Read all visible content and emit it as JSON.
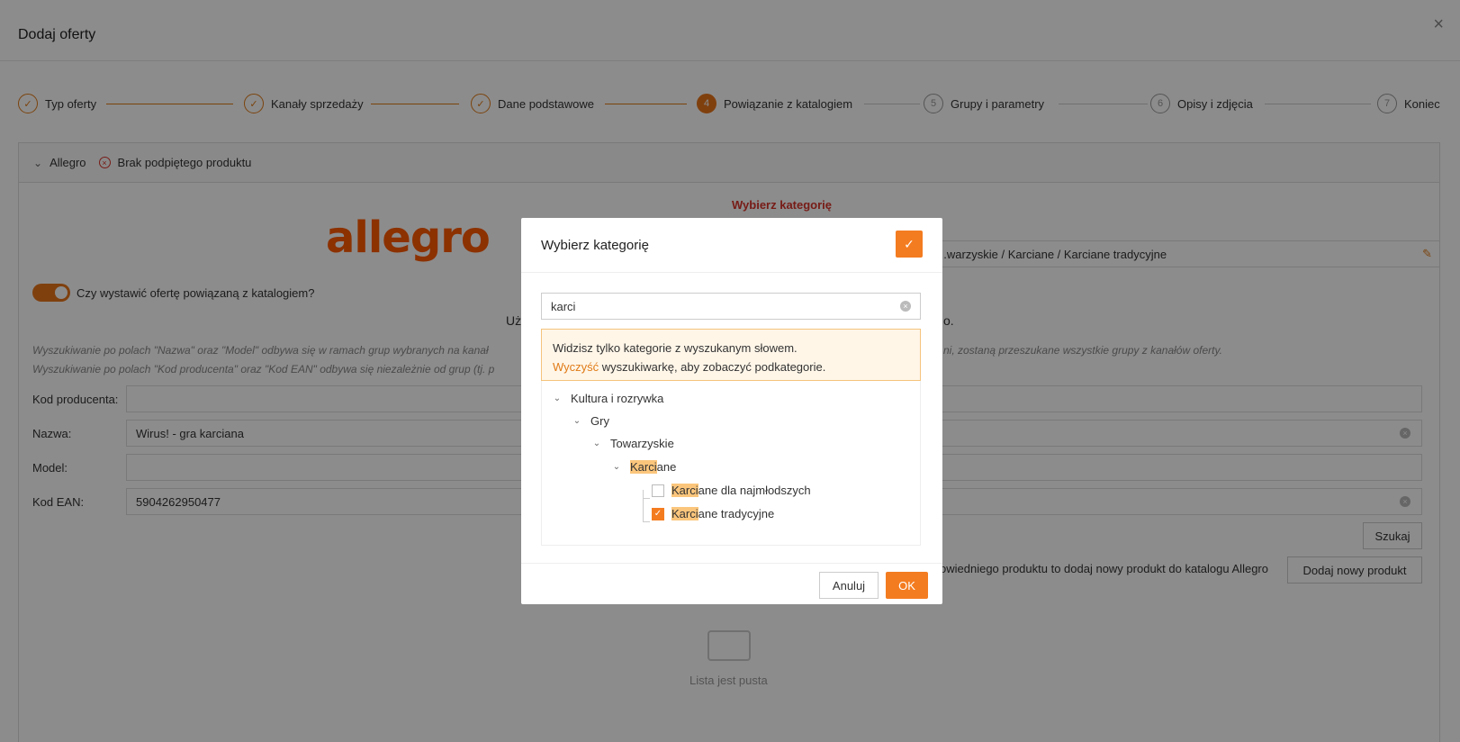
{
  "header": {
    "title": "Dodaj oferty",
    "close_icon": "×"
  },
  "steps": [
    {
      "label": "Typ oferty",
      "marker": "✓"
    },
    {
      "label": "Kanały sprzedaży",
      "marker": "✓"
    },
    {
      "label": "Dane podstawowe",
      "marker": "✓"
    },
    {
      "label": "Powiązanie z katalogiem",
      "marker": "4"
    },
    {
      "label": "Grupy i parametry",
      "marker": "5"
    },
    {
      "label": "Opisy i zdjęcia",
      "marker": "6"
    },
    {
      "label": "Koniec",
      "marker": "7"
    }
  ],
  "panel": {
    "chevron": "⌄",
    "channel": "Allegro",
    "error_icon": "×",
    "status": "Brak podpiętego produktu",
    "logo_text": "allegro",
    "category_title": "Wybierz kategorię",
    "category_path": "...warzyskie / Karciane / Karciane tradycyjne",
    "edit_icon": "✎",
    "toggle_label": "Czy wystawić ofertę powiązaną z katalogiem?",
    "center_note_start": "Uż",
    "center_note_end": "o.",
    "hint1_start": "Wyszukiwanie po polach \"Nazwa\" oraz \"Model\" odbywa się w ramach grup wybranych na kanał",
    "hint1_end": "ni, zostaną przeszukane wszystkie grupy z kanałów oferty.",
    "hint2_start": "Wyszukiwanie po polach \"Kod producenta\" oraz \"Kod EAN\" odbywa się niezależnie od grup (tj. p",
    "fields": {
      "producer_code_label": "Kod producenta:",
      "producer_code_value": "",
      "name_label": "Nazwa:",
      "name_value": "Wirus! - gra karciana",
      "model_label": "Model:",
      "model_value": "",
      "ean_label": "Kod EAN:",
      "ean_value": "5904262950477"
    },
    "search_button": "Szukaj",
    "add_text": "owiedniego produktu to dodaj nowy produkt do katalogu Allegro",
    "add_button": "Dodaj nowy produkt",
    "empty_text": "Lista jest pusta"
  },
  "modal": {
    "title": "Wybierz kategorię",
    "confirm_icon": "✓",
    "search_value": "karci",
    "notice_line1": "Widzisz tylko kategorie z wyszukanym słowem.",
    "notice_link": "Wyczyść",
    "notice_line2_rest": " wyszukiwarkę, aby zobaczyć podkategorie.",
    "tree": {
      "n1": "Kultura i rozrywka",
      "n2": "Gry",
      "n3": "Towarzyskie",
      "n4_hl": "Karci",
      "n4_rest": "ane",
      "n5_hl": "Karci",
      "n5_rest": "ane dla najmłodszych",
      "n5_checked": false,
      "n6_hl": "Karci",
      "n6_rest": "ane tradycyjne",
      "n6_checked": true
    },
    "cancel_label": "Anuluj",
    "ok_label": "OK"
  }
}
